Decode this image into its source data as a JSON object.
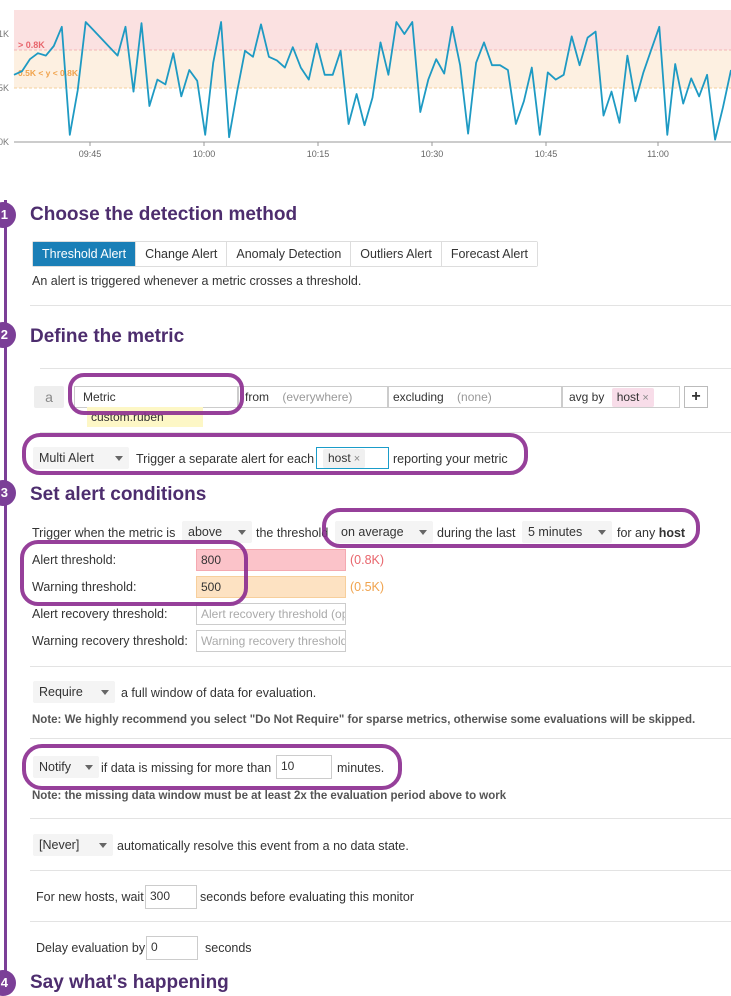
{
  "chart": {
    "y_ticks": [
      "1K",
      "5K",
      "0K"
    ],
    "x_ticks": [
      "09:45",
      "10:00",
      "10:15",
      "10:30",
      "10:45",
      "11:00"
    ],
    "alert_band_label": "> 0.8K",
    "warn_band_label": "0.5K < y < 0.8K",
    "colors": {
      "alert_band": "#fbe1e1",
      "warn_band": "#fdf0e1",
      "line": "#1e9ac3",
      "alert_text": "#e8656c",
      "warn_text": "#f0a34d"
    }
  },
  "chart_data": {
    "type": "line",
    "series": [
      {
        "values": [
          560,
          590,
          690,
          740,
          720,
          800,
          960,
          60,
          430,
          1000,
          930,
          860,
          790,
          720,
          960,
          420,
          990,
          300,
          520,
          480,
          740,
          380,
          600,
          510,
          60,
          660,
          1000,
          40,
          420,
          760,
          710,
          980,
          710,
          680,
          620,
          790,
          620,
          520,
          820,
          560,
          560,
          760,
          150,
          400,
          140,
          370,
          830,
          560,
          1000,
          900,
          1000,
          250,
          520,
          690,
          570,
          960,
          640,
          70,
          660,
          830,
          640,
          640,
          600,
          150,
          340,
          620,
          60,
          580,
          520,
          560,
          880,
          640,
          870,
          920,
          220,
          420,
          160,
          720,
          340,
          580,
          770,
          960,
          60,
          650,
          320,
          530,
          380,
          560,
          20,
          290,
          600
        ]
      }
    ],
    "ylim": [
      0,
      1100
    ],
    "x_ticks": [
      "09:45",
      "10:00",
      "10:15",
      "10:30",
      "10:45",
      "11:00"
    ],
    "y_ticks": [
      "1K",
      "5K",
      "0K"
    ],
    "thresholds": {
      "alert": 800,
      "warning": 500
    }
  },
  "sections": {
    "s1": {
      "num": "1",
      "title": "Choose the detection method"
    },
    "s2": {
      "num": "2",
      "title": "Define the metric"
    },
    "s3": {
      "num": "3",
      "title": "Set alert conditions"
    },
    "s4": {
      "num": "4",
      "title": "Say what's happening"
    }
  },
  "tabs": [
    {
      "label": "Threshold Alert"
    },
    {
      "label": "Change Alert"
    },
    {
      "label": "Anomaly Detection"
    },
    {
      "label": "Outliers Alert"
    },
    {
      "label": "Forecast Alert"
    }
  ],
  "detection_desc": "An alert is triggered whenever a metric crosses a threshold.",
  "metric": {
    "query_letter": "a",
    "metric_label": "Metric",
    "metric_value": "custom.ruben",
    "from_label": "from",
    "from_value": "(everywhere)",
    "excluding_label": "excluding",
    "excluding_value": "(none)",
    "avg_by_label": "avg by",
    "avg_by_tag": "host",
    "tag_remove": "×",
    "add": "+",
    "alert_type": "Multi Alert",
    "trigger_text": "Trigger a separate alert for each",
    "group_tag": "host",
    "reporting_text": "reporting your metric"
  },
  "conditions": {
    "trigger_prefix": "Trigger when the metric is",
    "comparator": "above",
    "threshold_text": "the threshold",
    "aggregation": "on average",
    "during_text": "during the last",
    "window": "5 minutes",
    "for_any": "for any",
    "for_any_group": "host",
    "alert_label": "Alert threshold:",
    "alert_value": "800",
    "alert_hint": "(0.8K)",
    "warning_label": "Warning threshold:",
    "warning_value": "500",
    "warning_hint": "(0.5K)",
    "alert_recovery_label": "Alert recovery threshold:",
    "alert_recovery_placeholder": "Alert recovery threshold (optional)",
    "warning_recovery_label": "Warning recovery threshold:",
    "warning_recovery_placeholder": "Warning recovery threshold"
  },
  "options": {
    "require_value": "Require",
    "require_text": "a full window of data for evaluation.",
    "require_note": "Note: We highly recommend you select \"Do Not Require\" for sparse metrics, otherwise some evaluations will be skipped.",
    "notify_value": "Notify",
    "notify_text": "if data is missing for more than",
    "notify_minutes": "10",
    "notify_suffix": "minutes.",
    "notify_note": "Note: the missing data window must be at least 2x the evaluation period above to work",
    "resolve_value": "[Never]",
    "resolve_text": "automatically resolve this event from a no data state.",
    "new_hosts_prefix": "For new hosts, wait",
    "new_hosts_value": "300",
    "new_hosts_suffix": "seconds before evaluating this monitor",
    "delay_prefix": "Delay evaluation by",
    "delay_value": "0",
    "delay_suffix": "seconds"
  }
}
